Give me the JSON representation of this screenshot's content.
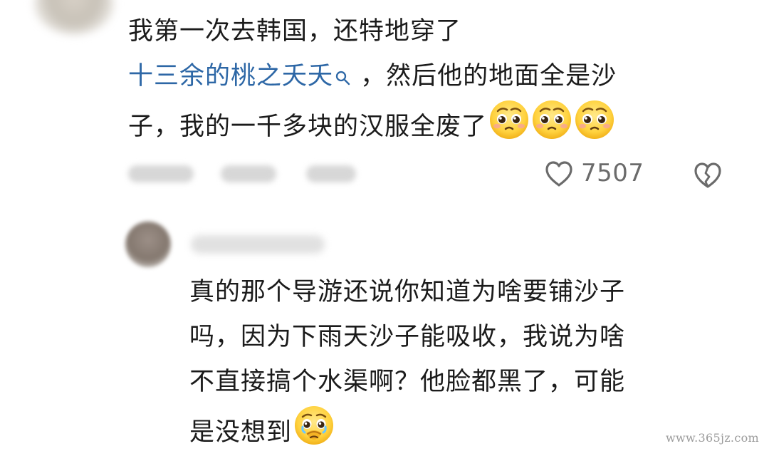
{
  "top_comment": {
    "avatar": "commenter-avatar-blurred",
    "lines": [
      "我第一次去韩国，还特地穿了",
      "，然后他的地面全是沙",
      "子，我的一千多块的汉服全废了"
    ],
    "link_text": "十三余的桃之夭夭",
    "emoji": "pleading-face-emoji",
    "emoji_count": 3,
    "likes": "7507",
    "like_icon": "heart-outline-icon",
    "dislike_icon": "broken-heart-outline-icon"
  },
  "reply": {
    "avatar": "replier-avatar-blurred",
    "lines": [
      "真的那个导游还说你知道为啥要铺沙子",
      "吗，因为下雨天沙子能吸收，我说为啥",
      "不直接搞个水渠啊？他脸都黑了，可能",
      "是没想到"
    ],
    "emoji": "holding-back-tears-emoji"
  },
  "colors": {
    "text": "#1b1b1b",
    "link": "#2d67a6",
    "meta": "#6b6b6b",
    "background": "#ffffff"
  },
  "watermark": "www.365jz.com"
}
